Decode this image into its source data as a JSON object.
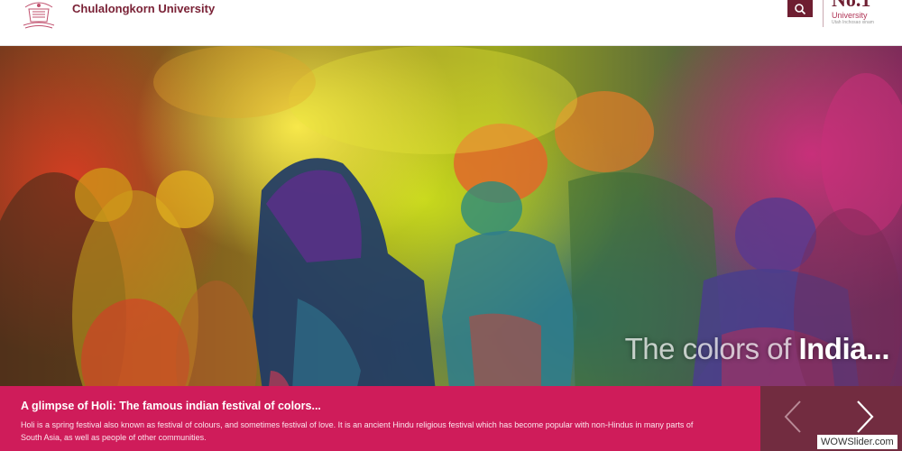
{
  "header": {
    "brand": "Chulalongkorn University",
    "rank_number": "No.1",
    "rank_label": "University",
    "rank_sub": "Utah Inchosao xinam",
    "search_icon": "search-icon",
    "logo_icon": "university-crest"
  },
  "hero": {
    "tagline_light": "The colors of ",
    "tagline_bold": "India..."
  },
  "caption": {
    "title": "A glimpse of Holi: The famous indian festival of colors...",
    "text": "Holi is a spring festival also known as festival of colours, and sometimes festival of love. It is an ancient Hindu religious festival which has become popular with non-Hindus in many parts of South Asia, as well as people of other communities."
  },
  "nav": {
    "prev_icon": "chevron-left-icon",
    "next_icon": "chevron-right-icon"
  },
  "watermark": "WOWSlider.com",
  "colors": {
    "brand": "#7a2236",
    "caption_bg": "#cf1c5a",
    "nav_bg": "#722c40"
  }
}
